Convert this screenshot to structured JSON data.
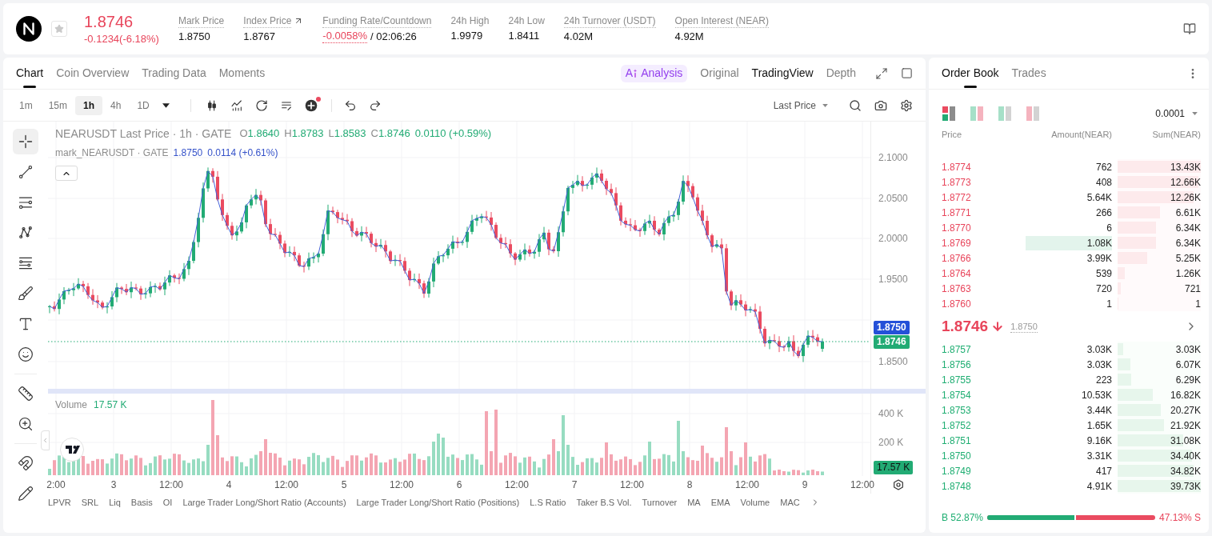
{
  "header": {
    "favorited": false,
    "price": "1.8746",
    "change": "-0.1234(-6.18%)",
    "stats": [
      {
        "kind": "plain",
        "label": "Mark Price",
        "tooltip": true,
        "value": "1.8750"
      },
      {
        "kind": "link",
        "label": "Index Price",
        "tooltip": true,
        "value": "1.8767"
      },
      {
        "kind": "funding",
        "label": "Funding Rate/Countdown",
        "tooltip": true,
        "value": "-0.0058%",
        "countdown": "/ 02:06:26"
      },
      {
        "kind": "plain",
        "label": "24h High",
        "tooltip": false,
        "value": "1.9979"
      },
      {
        "kind": "plain",
        "label": "24h Low",
        "tooltip": false,
        "value": "1.8411"
      },
      {
        "kind": "plain",
        "label": "24h Turnover (USDT)",
        "tooltip": true,
        "value": "4.02M"
      },
      {
        "kind": "plain",
        "label": "Open Interest (NEAR)",
        "tooltip": true,
        "value": "4.92M"
      }
    ]
  },
  "chart_panel": {
    "tabs": [
      {
        "label": "Chart",
        "selected": true
      },
      {
        "label": "Coin Overview",
        "selected": false
      },
      {
        "label": "Trading Data",
        "selected": false
      },
      {
        "label": "Moments",
        "selected": false
      }
    ],
    "views": [
      {
        "kind": "ai",
        "prefix": "A",
        "label": "Analysis",
        "selected": false
      },
      {
        "kind": "text",
        "label": "Original",
        "selected": false
      },
      {
        "kind": "text",
        "label": "TradingView",
        "selected": true
      },
      {
        "kind": "text",
        "label": "Depth",
        "selected": false
      }
    ],
    "intervals": [
      {
        "label": "1m",
        "selected": false
      },
      {
        "label": "15m",
        "selected": false
      },
      {
        "label": "1h",
        "selected": true
      },
      {
        "label": "4h",
        "selected": false
      },
      {
        "label": "1D",
        "selected": false
      }
    ],
    "alert_dot": true,
    "price_source": "Last Price",
    "drawing_tools": [
      {
        "tools": [
          {
            "kind": "crosshair",
            "selected": true
          },
          {
            "kind": "trend-line",
            "selected": false
          },
          {
            "kind": "horizontal-lines",
            "selected": false
          },
          {
            "kind": "pattern",
            "selected": false
          },
          {
            "kind": "fib",
            "selected": false
          },
          {
            "kind": "brush",
            "selected": false
          },
          {
            "kind": "text",
            "selected": false
          },
          {
            "kind": "emoji",
            "selected": false
          }
        ]
      },
      {
        "tools": [
          {
            "kind": "ruler",
            "selected": false
          },
          {
            "kind": "zoom",
            "selected": false
          }
        ]
      },
      {
        "tools": [
          {
            "kind": "magnet",
            "selected": false
          },
          {
            "kind": "pencil",
            "selected": false
          }
        ]
      }
    ],
    "legend": {
      "title": "NEARUSDT Last Price · 1h · GATE",
      "ohlc": [
        {
          "key": "O",
          "value": "1.8640"
        },
        {
          "key": "H",
          "value": "1.8783"
        },
        {
          "key": "L",
          "value": "1.8583"
        },
        {
          "key": "C",
          "value": "1.8746"
        }
      ],
      "change": "0.0110 (+0.59%)",
      "mark_title": "mark_NEARUSDT · GATE",
      "mark_price": "1.8750",
      "mark_change": "0.0114 (+0.61%)"
    },
    "price_axis": [
      "2.1000",
      "2.0500",
      "2.0000",
      "1.9500",
      "1.8500"
    ],
    "price_tags": [
      {
        "kind": "mark",
        "value": "1.8750"
      },
      {
        "kind": "last",
        "value": "1.8746"
      }
    ],
    "volume": {
      "label": "Volume",
      "value": "17.57 K",
      "axis": [
        "400 K",
        "200 K"
      ],
      "tag": "17.57 K"
    },
    "time_axis": [
      "2:00",
      "3",
      "12:00",
      "4",
      "12:00",
      "5",
      "12:00",
      "6",
      "12:00",
      "7",
      "12:00",
      "8",
      "12:00",
      "9",
      "12:00"
    ],
    "indicators": [
      "LPVR",
      "SRL",
      "Liq",
      "Basis",
      "OI",
      "Large Trader Long/Short Ratio (Accounts)",
      "Large Trader Long/Short Ratio (Positions)",
      "L.S Ratio",
      "Taker B.S Vol.",
      "Turnover",
      "MA",
      "EMA",
      "Volume",
      "MAC"
    ]
  },
  "order_book": {
    "tabs": [
      {
        "label": "Order Book",
        "selected": true
      },
      {
        "label": "Trades",
        "selected": false
      }
    ],
    "layouts": [
      {
        "kind": "both",
        "selected": true
      },
      {
        "kind": "split",
        "selected": false
      },
      {
        "kind": "bids",
        "selected": false
      },
      {
        "kind": "asks",
        "selected": false
      }
    ],
    "precision": "0.0001",
    "columns": [
      "Price",
      "Amount(NEAR)",
      "Sum(NEAR)"
    ],
    "asks": [
      {
        "price": "1.8774",
        "amount": "762",
        "sum": "13.43K",
        "level": 1,
        "flash": false
      },
      {
        "price": "1.8773",
        "amount": "408",
        "sum": "12.66K",
        "level": 0.97,
        "flash": false
      },
      {
        "price": "1.8772",
        "amount": "5.64K",
        "sum": "12.26K",
        "level": 0.91,
        "flash": false
      },
      {
        "price": "1.8771",
        "amount": "266",
        "sum": "6.61K",
        "level": 0.51,
        "flash": false
      },
      {
        "price": "1.8770",
        "amount": "6",
        "sum": "6.34K",
        "level": 0.46,
        "flash": false
      },
      {
        "price": "1.8769",
        "amount": "1.08K",
        "sum": "6.34K",
        "level": 0.46,
        "flash": true
      },
      {
        "price": "1.8766",
        "amount": "3.99K",
        "sum": "5.25K",
        "level": 0.36,
        "flash": false
      },
      {
        "price": "1.8764",
        "amount": "539",
        "sum": "1.26K",
        "level": 0.09,
        "flash": false
      },
      {
        "price": "1.8763",
        "amount": "720",
        "sum": "721",
        "level": 0.04,
        "flash": false
      },
      {
        "price": "1.8760",
        "amount": "1",
        "sum": "1",
        "level": 0,
        "flash": false
      }
    ],
    "last": {
      "price": "1.8746",
      "falling": true,
      "mark": "1.8750"
    },
    "bids": [
      {
        "price": "1.8757",
        "amount": "3.03K",
        "sum": "3.03K",
        "level": 0.07,
        "flash": false
      },
      {
        "price": "1.8756",
        "amount": "3.03K",
        "sum": "6.07K",
        "level": 0.15,
        "flash": false
      },
      {
        "price": "1.8755",
        "amount": "223",
        "sum": "6.29K",
        "level": 0.16,
        "flash": false
      },
      {
        "price": "1.8754",
        "amount": "10.53K",
        "sum": "16.82K",
        "level": 0.42,
        "flash": false
      },
      {
        "price": "1.8753",
        "amount": "3.44K",
        "sum": "20.27K",
        "level": 0.52,
        "flash": false
      },
      {
        "price": "1.8752",
        "amount": "1.65K",
        "sum": "21.92K",
        "level": 0.56,
        "flash": false
      },
      {
        "price": "1.8751",
        "amount": "9.16K",
        "sum": "31.08K",
        "level": 0.79,
        "flash": false
      },
      {
        "price": "1.8750",
        "amount": "3.31K",
        "sum": "34.40K",
        "level": 0.89,
        "flash": false
      },
      {
        "price": "1.8749",
        "amount": "417",
        "sum": "34.82K",
        "level": 0.91,
        "flash": false
      },
      {
        "price": "1.8748",
        "amount": "4.91K",
        "sum": "39.73K",
        "level": 1,
        "flash": false
      }
    ],
    "ratio": {
      "buy": "B 52.87%",
      "sell": "47.13% S",
      "level": 0.5287
    }
  }
}
